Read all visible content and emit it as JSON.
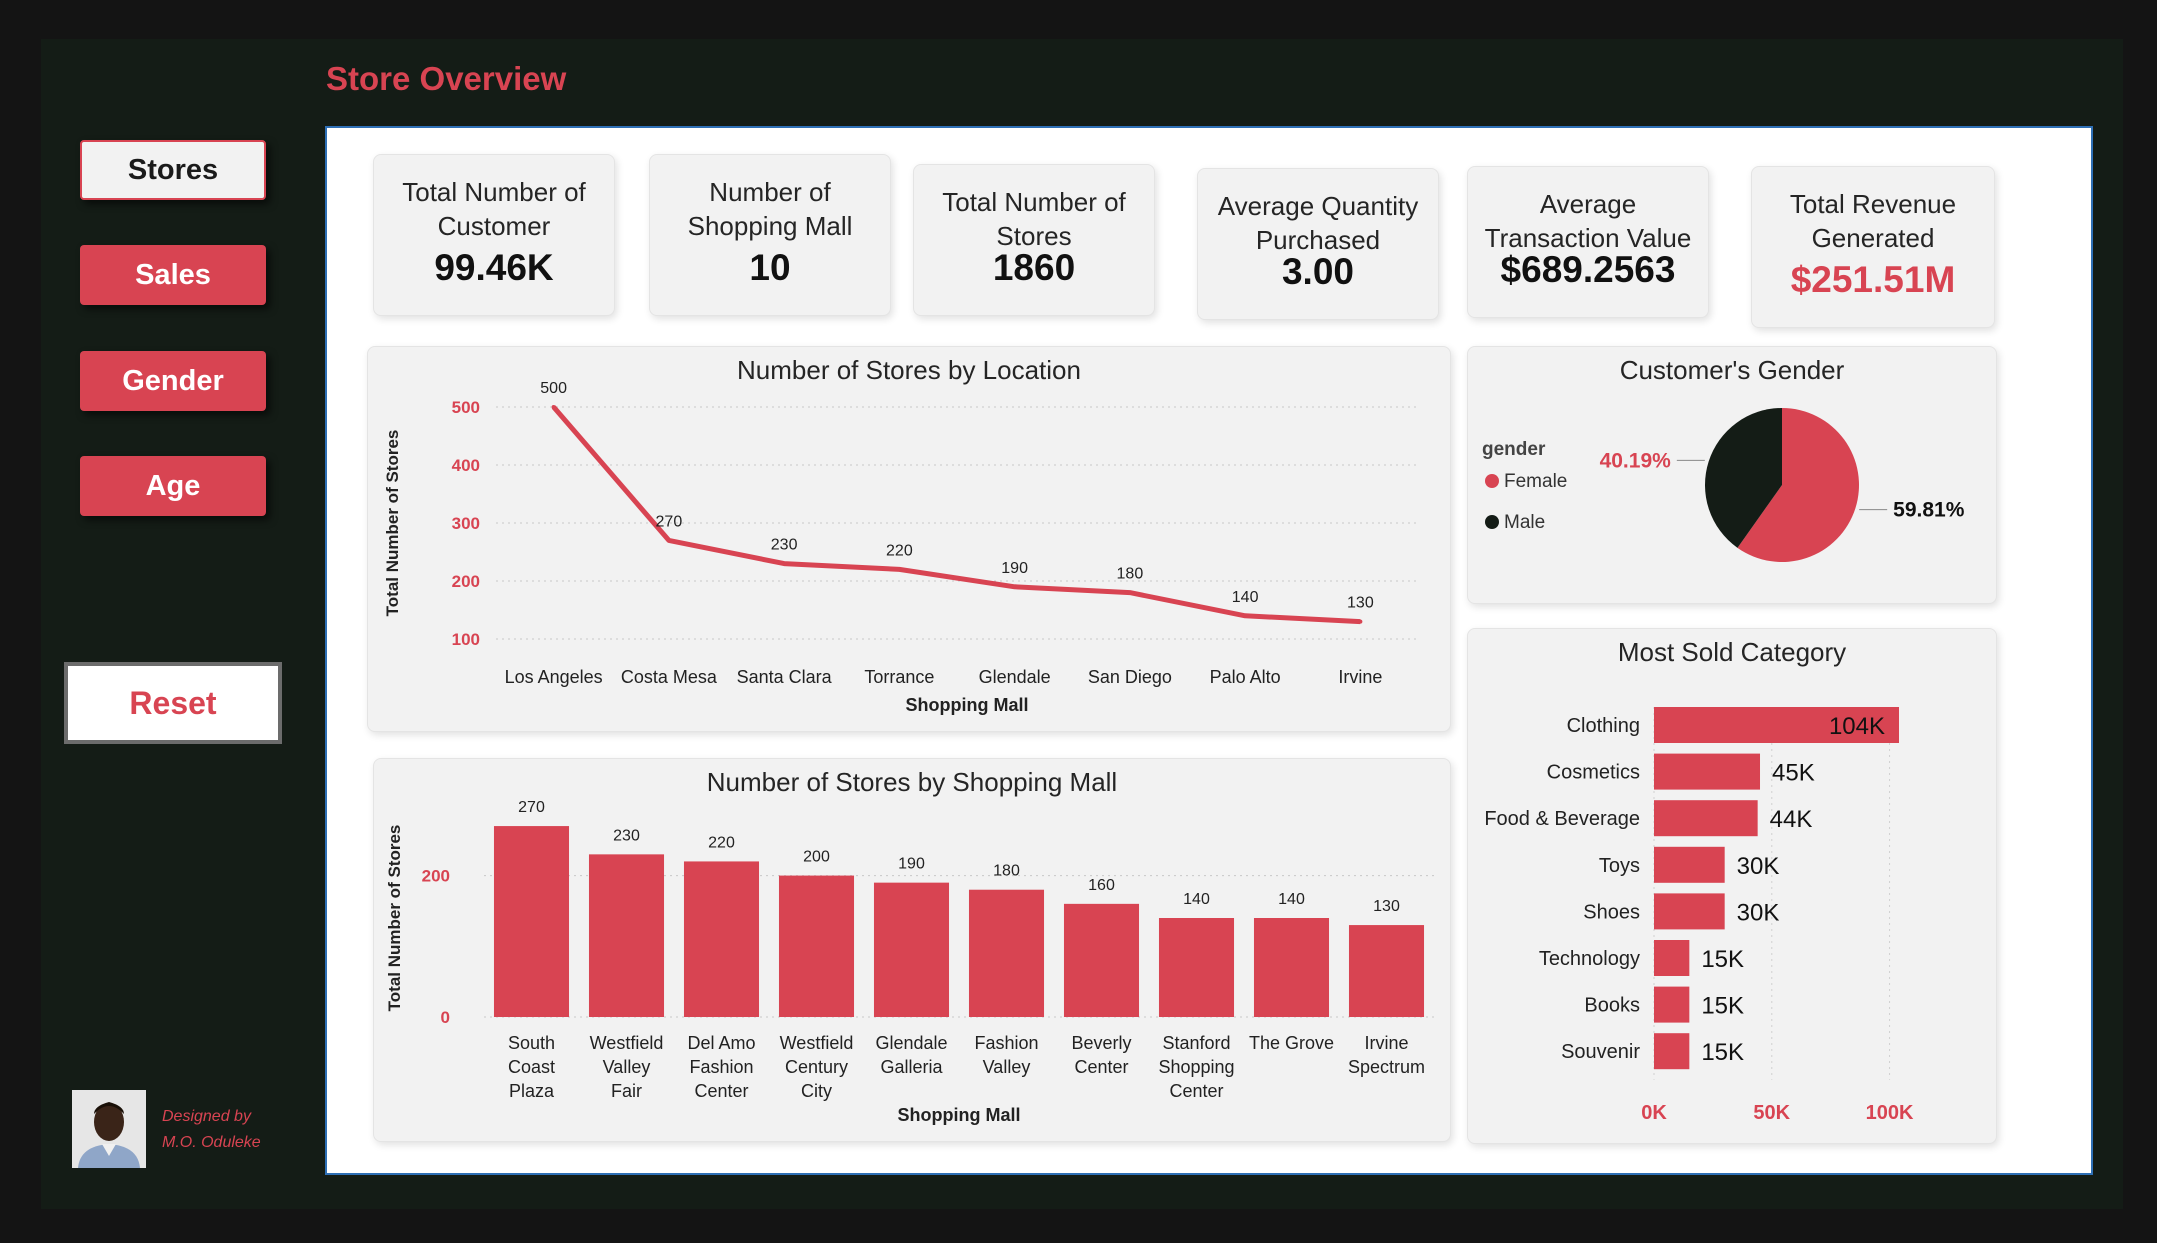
{
  "page_title": "Store Overview",
  "nav": {
    "stores": "Stores",
    "sales": "Sales",
    "gender": "Gender",
    "age": "Age",
    "reset": "Reset"
  },
  "designer": {
    "line1": "Designed by",
    "line2": "M.O. Oduleke"
  },
  "kpis": [
    {
      "label": "Total Number of Customer",
      "value": "99.46K"
    },
    {
      "label": "Number of Shopping Mall",
      "value": "10"
    },
    {
      "label": "Total Number of Stores",
      "value": "1860"
    },
    {
      "label": "Average Quantity Purchased",
      "value": "3.00"
    },
    {
      "label": "Average Transaction Value",
      "value": "$689.2563"
    },
    {
      "label": "Total Revenue Generated",
      "value": "$251.51M"
    }
  ],
  "colors": {
    "accent": "#d84452",
    "dark": "#141c16"
  },
  "chart_data": [
    {
      "type": "line",
      "title": "Number of Stores by Location",
      "xlabel": "Shopping Mall",
      "ylabel": "Total Number of Stores",
      "categories": [
        "Los Angeles",
        "Costa Mesa",
        "Santa Clara",
        "Torrance",
        "Glendale",
        "San Diego",
        "Palo Alto",
        "Irvine"
      ],
      "values": [
        500,
        270,
        230,
        220,
        190,
        180,
        140,
        130
      ],
      "yticks": [
        100,
        200,
        300,
        400,
        500
      ],
      "ylim": [
        100,
        500
      ],
      "grid": true
    },
    {
      "type": "bar",
      "title": "Number of Stores by Shopping Mall",
      "xlabel": "Shopping Mall",
      "ylabel": "Total Number of Stores",
      "categories": [
        [
          "South",
          "Coast",
          "Plaza"
        ],
        [
          "Westfield",
          "Valley",
          "Fair"
        ],
        [
          "Del Amo",
          "Fashion",
          "Center"
        ],
        [
          "Westfield",
          "Century",
          "City"
        ],
        [
          "Glendale",
          "Galleria"
        ],
        [
          "Fashion",
          "Valley"
        ],
        [
          "Beverly",
          "Center"
        ],
        [
          "Stanford",
          "Shopping",
          "Center"
        ],
        [
          "The Grove"
        ],
        [
          "Irvine",
          "Spectrum"
        ]
      ],
      "values": [
        270,
        230,
        220,
        200,
        190,
        180,
        160,
        140,
        140,
        130
      ],
      "yticks": [
        0,
        200
      ],
      "ylim": [
        0,
        280
      ],
      "grid": true
    },
    {
      "type": "pie",
      "title": "Customer's Gender",
      "legend_title": "gender",
      "legend_position": "left",
      "slices": [
        {
          "name": "Female",
          "value": 59.81,
          "label": "59.81%",
          "color": "#d84452"
        },
        {
          "name": "Male",
          "value": 40.19,
          "label": "40.19%",
          "color": "#141c16"
        }
      ]
    },
    {
      "type": "bar",
      "orientation": "horizontal",
      "title": "Most Sold Category",
      "categories": [
        "Clothing",
        "Cosmetics",
        "Food & Beverage",
        "Toys",
        "Shoes",
        "Technology",
        "Books",
        "Souvenir"
      ],
      "values": [
        104,
        45,
        44,
        30,
        30,
        15,
        15,
        15
      ],
      "labels": [
        "104K",
        "45K",
        "44K",
        "30K",
        "30K",
        "15K",
        "15K",
        "15K"
      ],
      "xticks": [
        "0K",
        "50K",
        "100K"
      ],
      "xlim": [
        0,
        115
      ],
      "grid": true
    }
  ]
}
